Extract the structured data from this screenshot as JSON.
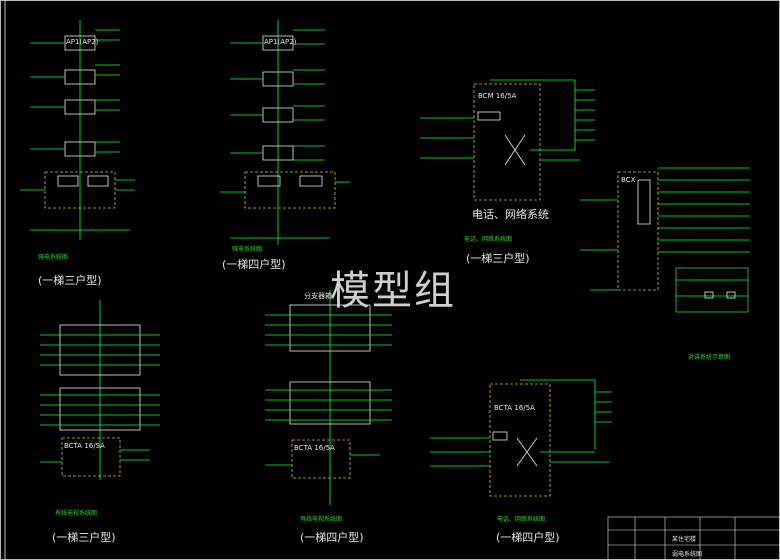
{
  "watermark": "模型组",
  "diagrams": {
    "d1": {
      "caption": "(一梯三户型)",
      "subtitle": "强电系统图",
      "panel": "AP1(AP2)"
    },
    "d2": {
      "caption": "(一梯四户型)",
      "subtitle": "强电系统图",
      "panel": "AP1(AP2)"
    },
    "d3": {
      "caption": "(一梯三户型)",
      "subtitle": "电话、网络系统图",
      "title": "电话、网络系统",
      "box": "BCM 16/5A"
    },
    "d4": {
      "caption": "",
      "subtitle": "对讲系统示意图",
      "box": "BCX"
    },
    "d5": {
      "caption": "(一梯三户型)",
      "subtitle": "有线电视系统图",
      "panel": "BCTA 16/5A"
    },
    "d6": {
      "caption": "(一梯四户型)",
      "subtitle": "有线电视系统图",
      "panel": "BCTA 16/5A",
      "note": "分支器箱"
    },
    "d7": {
      "caption": "(一梯四户型)",
      "subtitle": "电话、网络系统图",
      "box": "BCTA 16/5A"
    }
  },
  "title_block": {
    "project": "某住宅楼",
    "drawing": "弱电系统图"
  },
  "colors": {
    "line": "#00ff33",
    "lineAlt": "#2ed82e",
    "panel": "#e9e9e9",
    "text": "#ffffff",
    "dashed": "#d6c400",
    "accent": "#ff2a2a",
    "label": "#f0f0f0"
  }
}
